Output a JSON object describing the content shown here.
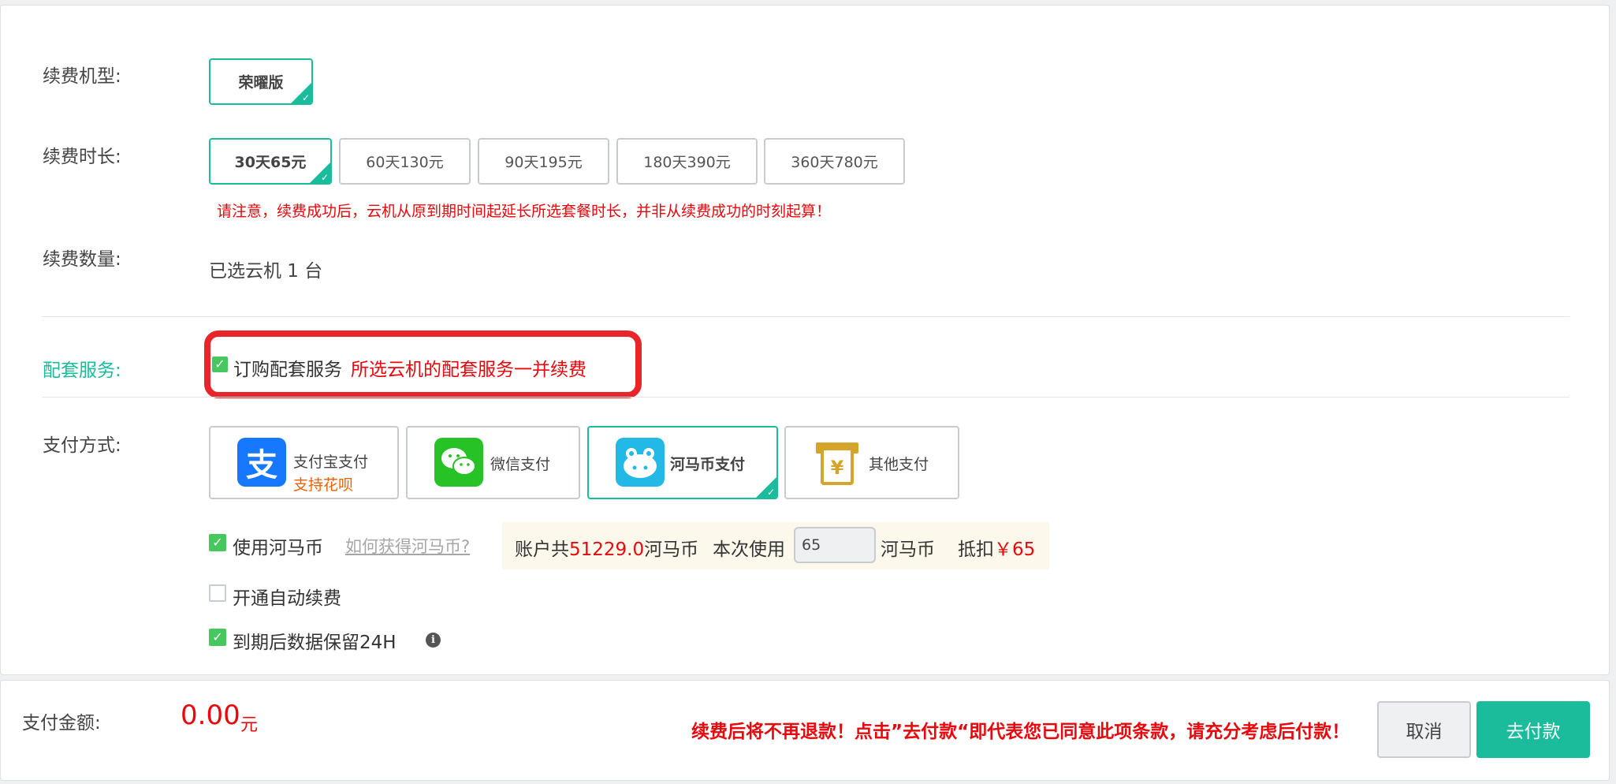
{
  "model": {
    "label": "续费机型:",
    "option": "荣曜版"
  },
  "duration": {
    "label": "续费时长:",
    "options": [
      "30天65元",
      "60天130元",
      "90天195元",
      "180天390元",
      "360天780元"
    ],
    "notice": "请注意，续费成功后，云机从原到期时间起延长所选套餐时长，并非从续费成功的时刻起算！"
  },
  "quantity": {
    "label": "续费数量:",
    "value": "已选云机 1 台"
  },
  "services": {
    "label": "配套服务:",
    "checkbox_label": "订购配套服务",
    "note": "所选云机的配套服务一并续费"
  },
  "payment": {
    "label": "支付方式:",
    "methods": [
      {
        "name": "支付宝支付",
        "sub": "支持花呗",
        "icon": "alipay-icon"
      },
      {
        "name": "微信支付",
        "icon": "wechat-icon"
      },
      {
        "name": "河马币支付",
        "icon": "hippo-icon"
      },
      {
        "name": "其他支付",
        "icon": "yuan-terminal-icon"
      }
    ]
  },
  "coins": {
    "use_label": "使用河马币",
    "how_link": "如何获得河马币?",
    "account_prefix": "账户共",
    "balance": "51229.0",
    "unit": "河马币",
    "use_prefix": "本次使用",
    "use_value": "65",
    "deduct_label": "抵扣",
    "deduct_amount": "￥65"
  },
  "auto_renew": {
    "label": "开通自动续费",
    "checked": false
  },
  "retain": {
    "label": "到期后数据保留24H",
    "checked": true
  },
  "footer": {
    "amount_label": "支付金额:",
    "amount": "0.00",
    "currency": "元",
    "warning": "续费后将不再退款！点击”去付款“即代表您已同意此项条款，请充分考虑后付款！",
    "cancel": "取消",
    "pay": "去付款"
  },
  "colors": {
    "accent": "#1bbc9b",
    "danger": "#e8070c",
    "check": "#47c85f",
    "highlight_box": "#e8262a"
  }
}
